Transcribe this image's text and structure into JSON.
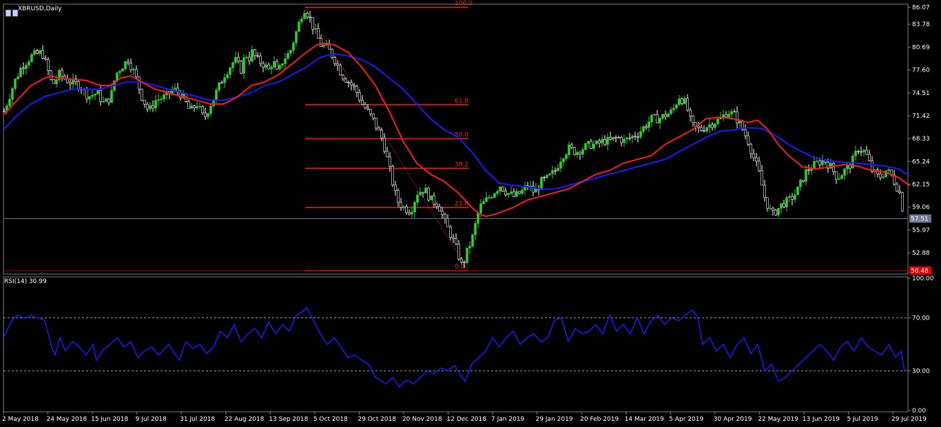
{
  "symbol_label": "XBRUSD,Daily",
  "rsi_label": "RSI(14) 30.99",
  "colors": {
    "background": "#000000",
    "bull": "#33cc33",
    "bear": "#ffffff",
    "ma_fast": "#ff1a1a",
    "ma_slow": "#1a1aff",
    "rsi": "#1a1aff",
    "fib": "#ff1a1a",
    "grid": "#808080",
    "current_price_line": "#6c7b92"
  },
  "chart_data": [
    {
      "type": "candlestick",
      "title": "XBRUSD,Daily",
      "ylim": [
        50.0,
        86.5
      ],
      "price_ticks": [
        "86.07",
        "83.78",
        "80.69",
        "77.60",
        "74.51",
        "71.42",
        "68.33",
        "65.24",
        "62.15",
        "59.06",
        "55.97",
        "52.88"
      ],
      "current_price": "57.51",
      "fib_anchor_low": "50.48",
      "date_ticks": [
        "2 May 2018",
        "24 May 2018",
        "15 Jun 2018",
        "9 Jul 2018",
        "31 Jul 2018",
        "22 Aug 2018",
        "13 Sep 2018",
        "5 Oct 2018",
        "29 Oct 2018",
        "20 Nov 2018",
        "12 Dec 2018",
        "7 Jan 2019",
        "29 Jan 2019",
        "20 Feb 2019",
        "14 Mar 2019",
        "5 Apr 2019",
        "30 Apr 2019",
        "22 May 2019",
        "13 Jun 2019",
        "5 Jul 2019",
        "29 Jul 2019"
      ],
      "fib_levels": [
        {
          "label": "100.0",
          "price": 86.07
        },
        {
          "label": "61.8",
          "price": 72.9
        },
        {
          "label": "50.0",
          "price": 68.3
        },
        {
          "label": "38.2",
          "price": 64.3
        },
        {
          "label": "23.6",
          "price": 59.0
        },
        {
          "label": "0.0",
          "price": 50.48
        }
      ],
      "close_path": {
        "x": [
          0,
          15,
          25,
          40,
          55,
          62,
          70,
          80,
          95,
          110,
          122,
          135,
          145,
          155,
          162,
          170,
          180,
          185,
          190,
          200,
          210,
          220,
          235,
          245,
          255,
          262,
          270,
          280,
          290,
          305,
          320,
          335,
          345,
          350,
          355,
          360,
          367,
          375,
          385,
          390,
          397,
          405,
          415,
          425,
          435,
          442,
          450,
          460,
          470,
          480,
          490,
          500,
          510,
          520,
          535,
          550,
          560,
          570,
          580,
          590,
          600,
          610,
          620,
          630,
          640,
          650,
          658,
          665,
          672,
          680,
          690,
          700,
          710,
          720,
          730,
          740,
          750,
          760,
          770,
          780,
          790,
          800,
          810,
          820,
          830,
          840,
          850,
          860,
          870,
          880,
          890,
          900,
          910,
          920,
          930,
          940,
          950,
          960,
          970,
          980,
          990,
          995,
          1000,
          1010,
          1020,
          1030,
          1040,
          1050,
          1060,
          1070,
          1080,
          1087,
          1095,
          1105,
          1115,
          1125,
          1130,
          1140,
          1150,
          1165,
          1180,
          1190,
          1200,
          1210,
          1220,
          1230,
          1240,
          1250,
          1260,
          1270,
          1280,
          1287,
          1295,
          1300,
          1306
        ],
        "y": [
          72,
          76,
          78,
          79.5,
          80,
          78,
          75.5,
          77,
          76,
          75.5,
          74,
          74.5,
          73,
          74,
          77,
          78,
          79,
          78,
          77,
          74,
          72,
          73.5,
          74,
          75,
          74.5,
          73.5,
          72,
          73,
          71,
          74,
          77,
          79,
          77.5,
          80,
          79,
          80,
          79,
          78.5,
          77.5,
          79,
          77,
          79,
          80,
          83,
          86,
          85,
          83,
          81,
          80.5,
          79,
          77,
          76,
          75,
          73,
          71,
          68,
          64,
          60,
          59,
          58.5,
          61,
          61.5,
          60,
          59.5,
          57,
          55,
          53,
          51,
          53,
          55,
          59,
          60,
          61,
          62,
          61,
          60.5,
          61,
          62,
          61,
          62.5,
          63,
          64,
          66,
          67,
          66.5,
          67,
          67.5,
          67.5,
          68,
          68,
          68.5,
          68,
          68.5,
          69,
          70,
          71,
          71,
          71.5,
          72,
          74,
          73,
          71,
          70,
          69.5,
          70,
          70.5,
          71,
          72,
          71.5,
          70,
          68,
          66,
          64,
          60,
          58,
          59,
          59.5,
          60,
          61,
          64,
          65,
          65.5,
          64.5,
          63,
          64,
          65,
          67,
          66.5,
          64,
          63,
          64,
          63.5,
          62,
          61,
          58,
          56.5
        ]
      },
      "ma_fast": {
        "x": [
          0,
          20,
          40,
          60,
          70,
          80,
          100,
          120,
          140,
          155,
          170,
          185,
          200,
          220,
          240,
          260,
          280,
          300,
          320,
          340,
          360,
          380,
          400,
          420,
          440,
          455,
          465,
          480,
          500,
          520,
          540,
          560,
          580,
          600,
          620,
          640,
          660,
          680,
          690,
          700,
          710,
          720,
          740,
          760,
          780,
          800,
          820,
          840,
          860,
          880,
          900,
          920,
          940,
          960,
          980,
          1000,
          1020,
          1040,
          1060,
          1080,
          1095,
          1110,
          1125,
          1140,
          1160,
          1180,
          1200,
          1220,
          1240,
          1260,
          1280,
          1300,
          1315
        ],
        "y": [
          71.5,
          73.5,
          75.5,
          76.5,
          76.8,
          76.5,
          76.3,
          76.2,
          75.5,
          75.5,
          76.5,
          76.8,
          76,
          75,
          74.5,
          74,
          73.5,
          73,
          73,
          74,
          75.5,
          76,
          77,
          78.5,
          80,
          81,
          81.2,
          81,
          80,
          78,
          75.5,
          72,
          68,
          65,
          63.5,
          62.5,
          61,
          59,
          58.2,
          57.8,
          58,
          58.3,
          59,
          60,
          60.5,
          61,
          61.5,
          62.5,
          63.5,
          64,
          65,
          65.5,
          66,
          67.5,
          68.5,
          69.5,
          71,
          71.2,
          71,
          70.5,
          70.8,
          69.5,
          67.5,
          66,
          64.5,
          64.2,
          64.5,
          64.8,
          64.6,
          64,
          63.8,
          63,
          62
        ]
      },
      "ma_slow": {
        "x": [
          0,
          20,
          40,
          60,
          80,
          100,
          120,
          140,
          160,
          180,
          200,
          220,
          240,
          260,
          280,
          300,
          320,
          340,
          360,
          380,
          400,
          420,
          440,
          460,
          480,
          500,
          520,
          540,
          560,
          580,
          600,
          620,
          640,
          660,
          680,
          700,
          720,
          740,
          760,
          780,
          800,
          820,
          840,
          860,
          880,
          900,
          920,
          940,
          960,
          980,
          1000,
          1020,
          1040,
          1060,
          1080,
          1100,
          1120,
          1140,
          1160,
          1180,
          1200,
          1220,
          1240,
          1260,
          1280,
          1300,
          1315
        ],
        "y": [
          69.5,
          71.5,
          73,
          74,
          74.5,
          75,
          75,
          75,
          75.5,
          76,
          76,
          75.5,
          75,
          74.5,
          74,
          73.5,
          73.5,
          74,
          74.5,
          75.5,
          76,
          77,
          78,
          79.3,
          79.8,
          79.5,
          79,
          78,
          76.5,
          75,
          73,
          71,
          69.5,
          68.5,
          66.5,
          64,
          62.3,
          62,
          61.8,
          61.5,
          61.5,
          62,
          62.5,
          63,
          63.5,
          64,
          64.5,
          65,
          65.5,
          66.5,
          67.5,
          68.5,
          69.3,
          69.5,
          69.8,
          69.7,
          68.8,
          67.5,
          66.5,
          65.6,
          65.3,
          65.1,
          65,
          64.8,
          64.6,
          64.2,
          63.3
        ]
      }
    },
    {
      "type": "line",
      "title": "RSI(14) 30.99",
      "ylim": [
        0,
        100
      ],
      "y_ticks": [
        "100.00",
        "70.00",
        "30.00",
        "0.00"
      ],
      "levels": [
        70,
        30
      ],
      "x": [
        0,
        12,
        20,
        30,
        40,
        50,
        60,
        70,
        75,
        82,
        90,
        100,
        110,
        120,
        130,
        135,
        145,
        155,
        165,
        175,
        185,
        195,
        205,
        215,
        225,
        240,
        255,
        265,
        275,
        285,
        295,
        305,
        315,
        325,
        335,
        345,
        355,
        365,
        375,
        385,
        395,
        405,
        415,
        425,
        435,
        440,
        450,
        460,
        470,
        480,
        490,
        500,
        510,
        520,
        530,
        540,
        550,
        555,
        565,
        575,
        585,
        595,
        605,
        615,
        625,
        635,
        645,
        655,
        665,
        670,
        680,
        690,
        700,
        710,
        720,
        730,
        740,
        750,
        760,
        770,
        780,
        790,
        800,
        810,
        820,
        830,
        840,
        850,
        860,
        870,
        880,
        890,
        900,
        910,
        920,
        930,
        940,
        950,
        960,
        970,
        980,
        990,
        1000,
        1008,
        1015,
        1025,
        1035,
        1045,
        1055,
        1065,
        1075,
        1085,
        1095,
        1105,
        1115,
        1125,
        1135,
        1145,
        1155,
        1165,
        1175,
        1185,
        1195,
        1205,
        1215,
        1225,
        1235,
        1245,
        1255,
        1265,
        1275,
        1285,
        1295,
        1303,
        1308
      ],
      "y": [
        55,
        68,
        72,
        70,
        72,
        70,
        68,
        48,
        42,
        55,
        45,
        52,
        48,
        42,
        50,
        38,
        46,
        50,
        55,
        48,
        52,
        40,
        45,
        48,
        42,
        50,
        38,
        52,
        47,
        50,
        43,
        48,
        60,
        55,
        65,
        52,
        58,
        62,
        55,
        67,
        58,
        65,
        60,
        72,
        75,
        78,
        68,
        58,
        50,
        55,
        48,
        40,
        42,
        38,
        35,
        25,
        22,
        20,
        25,
        18,
        23,
        20,
        25,
        30,
        28,
        32,
        30,
        34,
        26,
        22,
        35,
        40,
        45,
        55,
        48,
        55,
        60,
        50,
        55,
        58,
        52,
        55,
        68,
        70,
        52,
        62,
        58,
        60,
        65,
        58,
        72,
        60,
        65,
        58,
        70,
        58,
        68,
        72,
        65,
        70,
        68,
        72,
        76,
        70,
        50,
        55,
        45,
        50,
        40,
        50,
        55,
        43,
        50,
        30,
        35,
        22,
        25,
        30,
        35,
        40,
        45,
        50,
        45,
        38,
        48,
        52,
        45,
        55,
        48,
        45,
        42,
        50,
        40,
        45,
        30,
        32
      ]
    }
  ]
}
